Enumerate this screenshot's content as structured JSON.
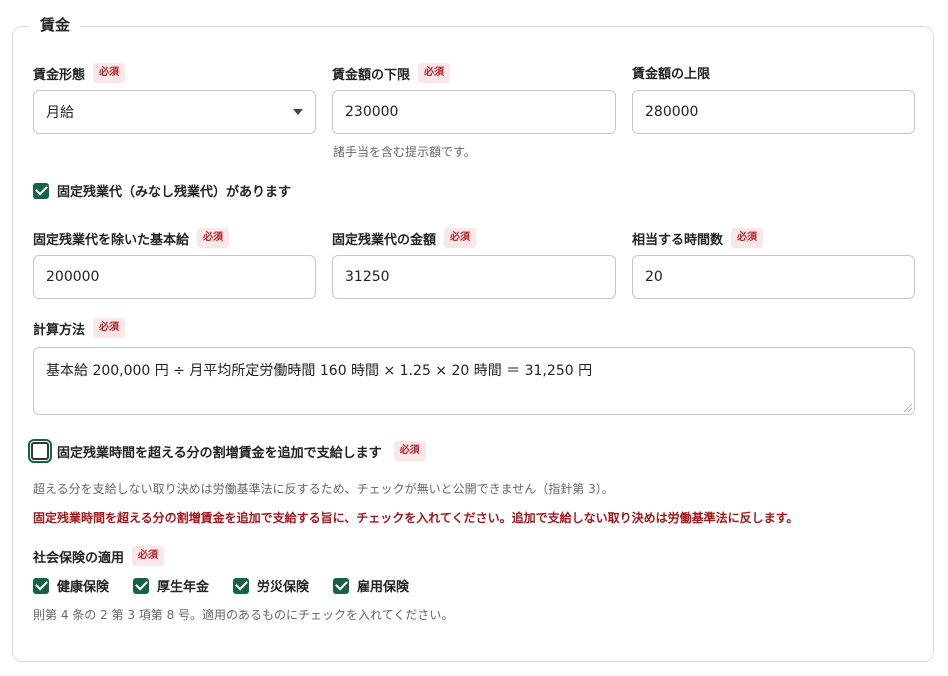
{
  "section_title": "賃金",
  "required_badge": "必須",
  "wage_type": {
    "label": "賃金形態",
    "value": "月給"
  },
  "wage_min": {
    "label": "賃金額の下限",
    "value": "230000",
    "hint": "諸手当を含む提示額です。"
  },
  "wage_max": {
    "label": "賃金額の上限",
    "value": "280000"
  },
  "fixed_overtime_check": {
    "label": "固定残業代（みなし残業代）があります",
    "checked": true
  },
  "base_salary": {
    "label": "固定残業代を除いた基本給",
    "value": "200000"
  },
  "fixed_overtime_amount": {
    "label": "固定残業代の金額",
    "value": "31250"
  },
  "hours": {
    "label": "相当する時間数",
    "value": "20"
  },
  "calc_method": {
    "label": "計算方法",
    "value": "基本給 200,000 円 ÷ 月平均所定労働時間 160 時間 × 1.25 × 20 時間 ＝ 31,250 円"
  },
  "extra_wage_check": {
    "label": "固定残業時間を超える分の割増賃金を追加で支給します",
    "checked": false,
    "hint": "超える分を支給しない取り決めは労働基準法に反するため、チェックが無いと公開できません（指針第 3）。",
    "error": "固定残業時間を超える分の割増賃金を追加で支給する旨に、チェックを入れてください。追加で支給しない取り決めは労働基準法に反します。"
  },
  "social_insurance": {
    "label": "社会保険の適用",
    "items": [
      {
        "label": "健康保険",
        "checked": true
      },
      {
        "label": "厚生年金",
        "checked": true
      },
      {
        "label": "労災保険",
        "checked": true
      },
      {
        "label": "雇用保険",
        "checked": true
      }
    ],
    "hint": "則第 4 条の 2 第 3 項第 8 号。適用のあるものにチェックを入れてください。"
  },
  "colors": {
    "accent": "#17614a",
    "required_bg": "#fbe7e7",
    "required_fg": "#b3262a",
    "error": "#a3171b"
  }
}
